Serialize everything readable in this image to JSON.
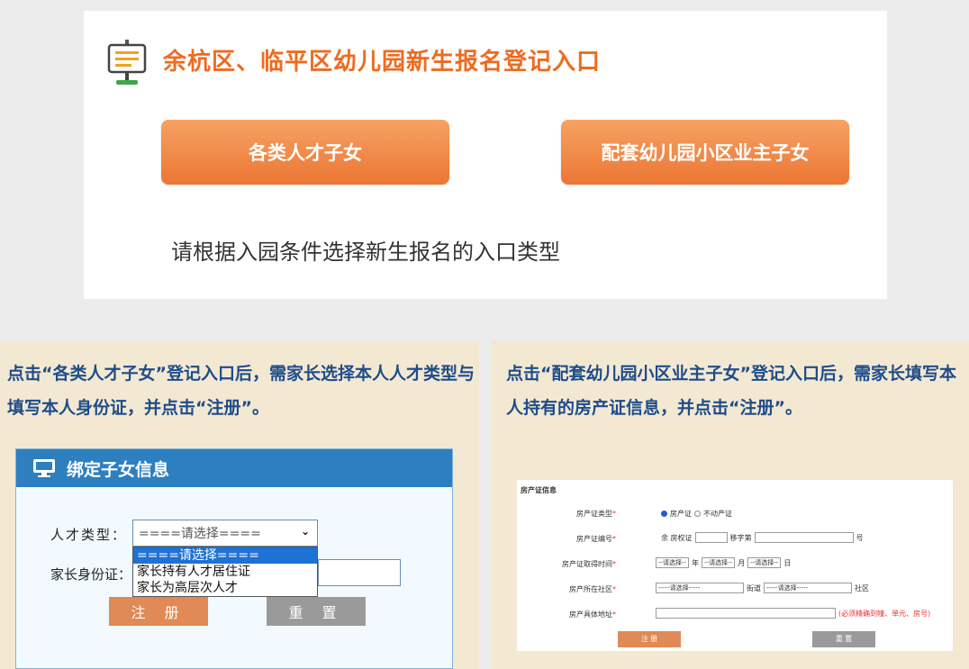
{
  "portal": {
    "title": "余杭区、临平区幼儿园新生报名登记入口",
    "btn_talent": "各类人才子女",
    "btn_community": "配套幼儿园小区业主子女",
    "hint": "请根据入园条件选择新生报名的入口类型"
  },
  "left_panel": {
    "text": "点击“各类人才子女”登记入口后，需家长选择本人人才类型与填写本人身份证，并点击“注册”。",
    "bind_title": "绑定子女信息",
    "label_type": "人才类型：",
    "label_id": "家长身份证：",
    "select_value": "====请选择====",
    "options": [
      "====请选择====",
      "家长持有人才居住证",
      "家长为高层次人才"
    ],
    "btn_register": "注 册",
    "btn_reset": "重 置"
  },
  "right_panel": {
    "text": "点击“配套幼儿园小区业主子女”登记入口后，需家长填写本人持有的房产证信息，并点击“注册”。",
    "form_title": "房产证信息",
    "row1_label": "房产证类型",
    "row1_opt1": "房产证",
    "row1_opt2": "不动产证",
    "row2_label": "房产证编号",
    "row2_prefix": "余 房权证",
    "row2_mid": "移字第",
    "row2_suffix": "号",
    "row3_label": "房产证取得时间",
    "row3_select": "--请选择--",
    "row3_year": "年",
    "row3_month": "月",
    "row3_day": "日",
    "row4_label": "房产所在社区",
    "row4_select": "-----请选择-----",
    "row4_street": "街道",
    "row4_community": "社区",
    "row5_label": "房产具体地址",
    "row5_note": "(必须精确到幢、单元、房号)",
    "btn_register": "注 册",
    "btn_reset": "重 置",
    "required_mark": "*"
  },
  "colors": {
    "accent": "#ee6b1f",
    "panel_text": "#1e4c8a",
    "header_blue": "#2e7fbf"
  }
}
